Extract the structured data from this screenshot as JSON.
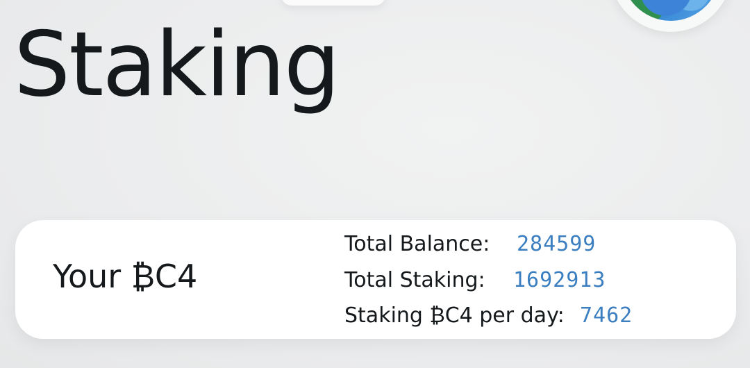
{
  "page": {
    "title": "Staking"
  },
  "card": {
    "title": "Your ₿C4",
    "stats": [
      {
        "label": "Total Balance:",
        "value": "284599"
      },
      {
        "label": "Total Staking:",
        "value": "1692913"
      },
      {
        "label": "Staking ₿C4 per day:",
        "value": "7462"
      }
    ]
  },
  "colors": {
    "background": "#ebeced",
    "card": "#ffffff",
    "text": "#15191b",
    "value_accent": "#3b7fc0"
  },
  "icons": {
    "avatar": "user-avatar"
  }
}
